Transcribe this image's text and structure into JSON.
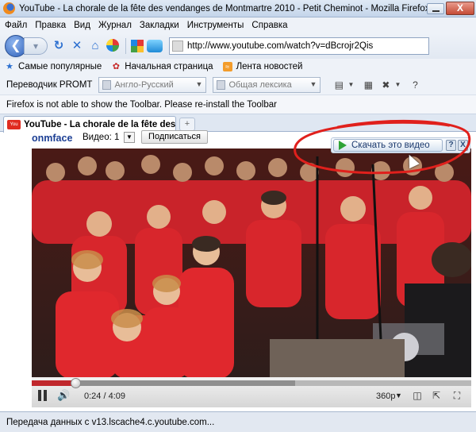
{
  "window": {
    "title": "YouTube - La chorale de la fête des vendanges de Montmartre 2010 - Petit Cheminot - Mozilla Firefox",
    "close_glyph": "X"
  },
  "menu": [
    "Файл",
    "Правка",
    "Вид",
    "Журнал",
    "Закладки",
    "Инструменты",
    "Справка"
  ],
  "nav": {
    "url": "http://www.youtube.com/watch?v=dBcrojr2Qis"
  },
  "bookmarks": [
    {
      "label": "Самые популярные",
      "icon": "bookmark-star-icon"
    },
    {
      "label": "Начальная страница",
      "icon": "start-page-icon"
    },
    {
      "label": "Лента новостей",
      "icon": "rss-icon"
    }
  ],
  "promt": {
    "label": "Переводчик PROMT",
    "direction": "Англо-Русский",
    "topic": "Общая лексика"
  },
  "firefox_notice": "Firefox is not able to show the Toolbar. Please re-install the Toolbar",
  "tabs": [
    {
      "title": "YouTube - La chorale de la fête des v..."
    }
  ],
  "page": {
    "channel": "onmface",
    "views_label": "Видео: 1",
    "subscribe_label": "Подписаться"
  },
  "downloader": {
    "button_label": "Скачать это видео",
    "help_label": "?",
    "close_label": "X"
  },
  "player": {
    "current_time": "0:24",
    "duration": "4:09",
    "time_text": "0:24 / 4:09",
    "quality": "360p",
    "progress_played": 0.1,
    "progress_buffered": 0.6
  },
  "status": "Передача данных с v13.lscache4.c.youtube.com...",
  "colors": {
    "annotation_red": "#e0201c",
    "download_green": "#2ea335",
    "player_red": "#c0282d",
    "titlebar_blue": "#c4d5ea"
  }
}
